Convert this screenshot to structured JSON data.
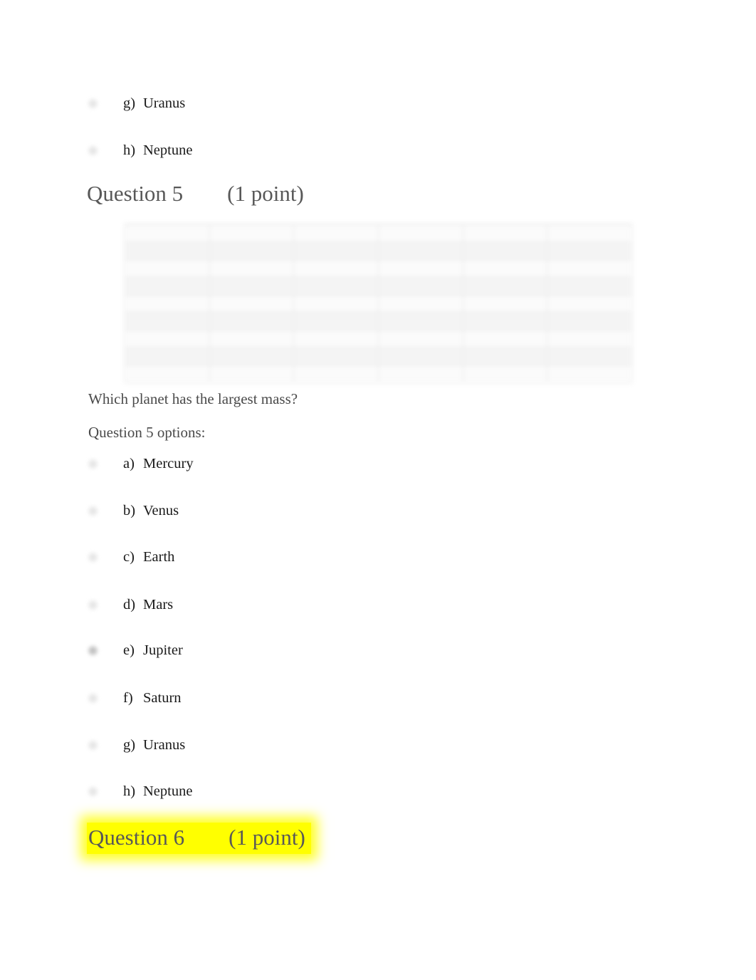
{
  "document": {
    "kind": "online-quiz-printout"
  },
  "prev_question_options": [
    {
      "letter": "g)",
      "label": "Uranus",
      "selected": false
    },
    {
      "letter": "h)",
      "label": "Neptune",
      "selected": false
    }
  ],
  "question5": {
    "heading": "Question 5        (1 point)",
    "prompt": "Which planet has the largest mass?",
    "options_label": "Question 5 options:",
    "options": [
      {
        "letter": "a)",
        "label": "Mercury",
        "selected": false
      },
      {
        "letter": "b)",
        "label": "Venus",
        "selected": false
      },
      {
        "letter": "c)",
        "label": "Earth",
        "selected": false
      },
      {
        "letter": "d)",
        "label": "Mars",
        "selected": false
      },
      {
        "letter": "e)",
        "label": "Jupiter",
        "selected": true
      },
      {
        "letter": "f)",
        "label": "Saturn",
        "selected": false
      },
      {
        "letter": "g)",
        "label": "Uranus",
        "selected": false
      },
      {
        "letter": "h)",
        "label": "Neptune",
        "selected": false
      }
    ]
  },
  "question6": {
    "heading": "Question 6        (1 point)",
    "highlight_color": "#ffff00"
  },
  "chart_data": {
    "type": "table",
    "title": "",
    "note": "Planetary data table rendered too blurred to read in the source image; column headers and cell values are illegible.",
    "legible": false,
    "columns": [
      "",
      "",
      "",
      "",
      "",
      ""
    ],
    "rows": [
      [
        "",
        "",
        "",
        "",
        "",
        ""
      ],
      [
        "",
        "",
        "",
        "",
        "",
        ""
      ],
      [
        "",
        "",
        "",
        "",
        "",
        ""
      ],
      [
        "",
        "",
        "",
        "",
        "",
        ""
      ],
      [
        "",
        "",
        "",
        "",
        "",
        ""
      ],
      [
        "",
        "",
        "",
        "",
        "",
        ""
      ],
      [
        "",
        "",
        "",
        "",
        "",
        ""
      ],
      [
        "",
        "",
        "",
        "",
        "",
        ""
      ],
      [
        "",
        "",
        "",
        "",
        "",
        ""
      ]
    ]
  }
}
